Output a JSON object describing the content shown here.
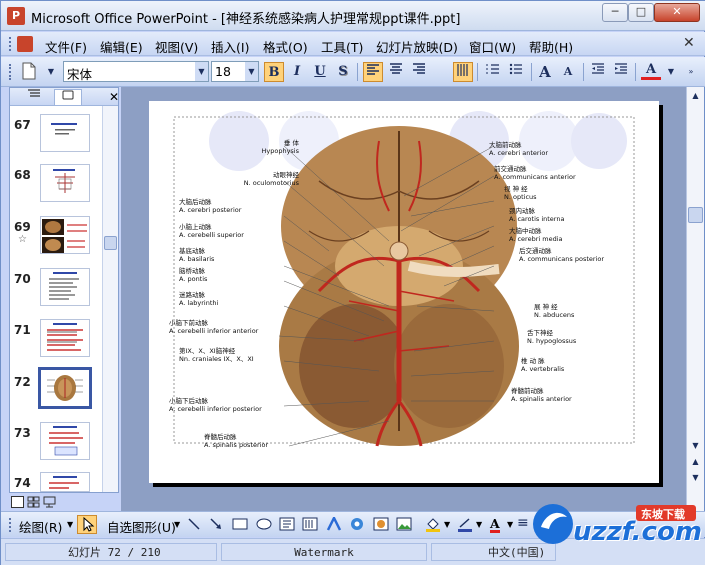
{
  "window": {
    "title": "Microsoft Office PowerPoint - [神经系统感染病人护理常规ppt课件.ppt]",
    "minimize_glyph": "─",
    "maximize_glyph": "□",
    "close_glyph": "✕"
  },
  "menu": {
    "items": [
      "文件(F)",
      "编辑(E)",
      "视图(V)",
      "插入(I)",
      "格式(O)",
      "工具(T)",
      "幻灯片放映(D)",
      "窗口(W)",
      "帮助(H)"
    ],
    "close_glyph": "✕"
  },
  "toolbar": {
    "font_name": "宋体",
    "font_size": "18",
    "bold": "B",
    "italic": "I",
    "underline": "U",
    "shadow": "S",
    "grow_font": "A",
    "shrink_font": "A",
    "font_color": "A"
  },
  "slides_panel": {
    "slide_numbers": [
      "67",
      "68",
      "69",
      "70",
      "71",
      "72",
      "73",
      "74"
    ],
    "selected": "72",
    "star_mark": "☆"
  },
  "slide": {
    "diagram_left_labels": [
      {
        "cn": "垂 体",
        "en": "Hypophysis"
      },
      {
        "cn": "动眼神经",
        "en": "N. oculomotorius"
      },
      {
        "cn": "大脑后动脉",
        "en": "A. cerebri posterior"
      },
      {
        "cn": "小脑上动脉",
        "en": "A. cerebelli superior"
      },
      {
        "cn": "基底动脉",
        "en": "A. basilaris"
      },
      {
        "cn": "脑桥动脉",
        "en": "A. pontis"
      },
      {
        "cn": "迷路动脉",
        "en": "A. labyrinthi"
      },
      {
        "cn": "小脑下前动脉",
        "en": "A. cerebelli inferior anterior"
      },
      {
        "cn": "第IX、X、XI脑神经",
        "en": "Nn. craniales IX、X、XI"
      },
      {
        "cn": "小脑下后动脉",
        "en": "A. cerebelli inferior posterior"
      },
      {
        "cn": "脊髓后动脉",
        "en": "A. spinalis posterior"
      }
    ],
    "diagram_right_labels": [
      {
        "cn": "大脑前动脉",
        "en": "A. cerebri anterior"
      },
      {
        "cn": "前交通动脉",
        "en": "A. communicans anterior"
      },
      {
        "cn": "视 神 经",
        "en": "N. opticus"
      },
      {
        "cn": "颈内动脉",
        "en": "A. carotis interna"
      },
      {
        "cn": "大脑中动脉",
        "en": "A. cerebri media"
      },
      {
        "cn": "后交通动脉",
        "en": "A. communicans posterior"
      },
      {
        "cn": "展 神 经",
        "en": "N. abducens"
      },
      {
        "cn": "舌下神经",
        "en": "N. hypoglossus"
      },
      {
        "cn": "椎 动 脉",
        "en": "A. vertebralis"
      },
      {
        "cn": "脊髓前动脉",
        "en": "A. spinalis anterior"
      }
    ]
  },
  "drawbar": {
    "draw_label": "绘图(R)",
    "autoshapes_label": "自选图形(U)"
  },
  "statusbar": {
    "slide_info": "幻灯片 72 / 210",
    "design": "Watermark",
    "language": "中文(中国)"
  },
  "watermark": {
    "logo_text": "uzzf.com",
    "logo_badge": "东坡下载"
  },
  "colors": {
    "accent": "#3a57a4",
    "toolbar": "#c4d4f1",
    "slide_bg": "#8d9fc4"
  }
}
